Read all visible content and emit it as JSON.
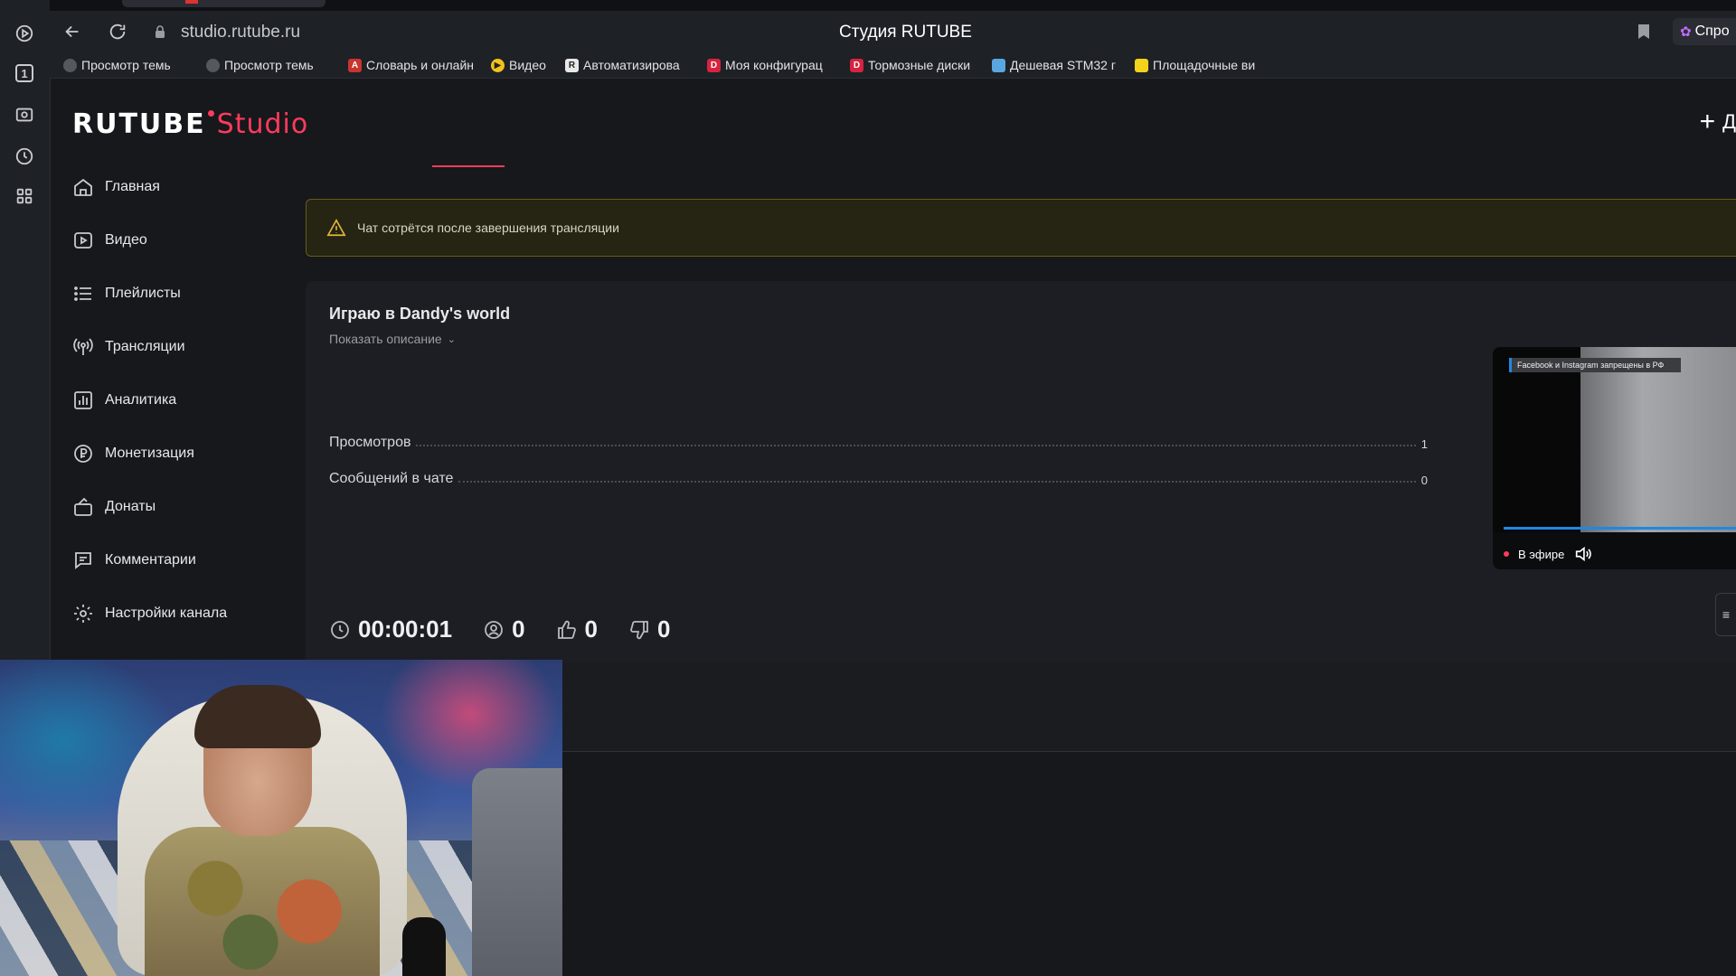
{
  "browser": {
    "url": "studio.rutube.ru",
    "title": "Студия RUTUBE",
    "ask_label": "Спро",
    "bookmarks": [
      {
        "label": "Просмотр темы -",
        "fav": "",
        "fav_color": "#55585e"
      },
      {
        "label": "Просмотр темы -",
        "fav": "",
        "fav_color": "#55585e"
      },
      {
        "label": "Словарь и онлайн",
        "fav": "A",
        "fav_color": "#c8352e"
      },
      {
        "label": "Видео",
        "fav": "▶",
        "fav_color": "#f2c21b"
      },
      {
        "label": "Автоматизирова",
        "fav": "R",
        "fav_color": "#e8e8e8"
      },
      {
        "label": "Моя конфигурац",
        "fav": "D",
        "fav_color": "#d8233f"
      },
      {
        "label": "Тормозные диски",
        "fav": "D",
        "fav_color": "#d8233f"
      },
      {
        "label": "Дешевая STM32 г",
        "fav": "",
        "fav_color": "#5aa6e0"
      },
      {
        "label": "Площадочные ви",
        "fav": "",
        "fav_color": "#f2d21b"
      }
    ]
  },
  "app": {
    "logo_main": "RUTUBE",
    "logo_sub": "Studio",
    "add_label": "Д"
  },
  "sidebar": {
    "items": [
      {
        "label": "Главная",
        "icon": "home-icon"
      },
      {
        "label": "Видео",
        "icon": "video-icon"
      },
      {
        "label": "Плейлисты",
        "icon": "playlist-icon"
      },
      {
        "label": "Трансляции",
        "icon": "broadcast-icon"
      },
      {
        "label": "Аналитика",
        "icon": "analytics-icon"
      },
      {
        "label": "Монетизация",
        "icon": "ruble-icon"
      },
      {
        "label": "Донаты",
        "icon": "donate-icon"
      },
      {
        "label": "Комментарии",
        "icon": "comments-icon"
      },
      {
        "label": "Настройки канала",
        "icon": "gear-icon"
      }
    ]
  },
  "warning": {
    "text": "Чат сотрётся после завершения трансляции"
  },
  "stream": {
    "title": "Играю в Dandy's world",
    "show_description": "Показать описание",
    "stats": [
      {
        "label": "Просмотров",
        "value": "1"
      },
      {
        "label": "Сообщений в чате",
        "value": "0"
      }
    ],
    "duration": "00:00:01",
    "viewers": "0",
    "likes": "0",
    "dislikes": "0"
  },
  "player": {
    "ticker": "Facebook и Instagram запрещены в РФ",
    "live_label": "В эфире"
  },
  "colors": {
    "accent": "#ff3b5c",
    "warning_icon": "#e0b640",
    "progress": "#1e88e5"
  }
}
